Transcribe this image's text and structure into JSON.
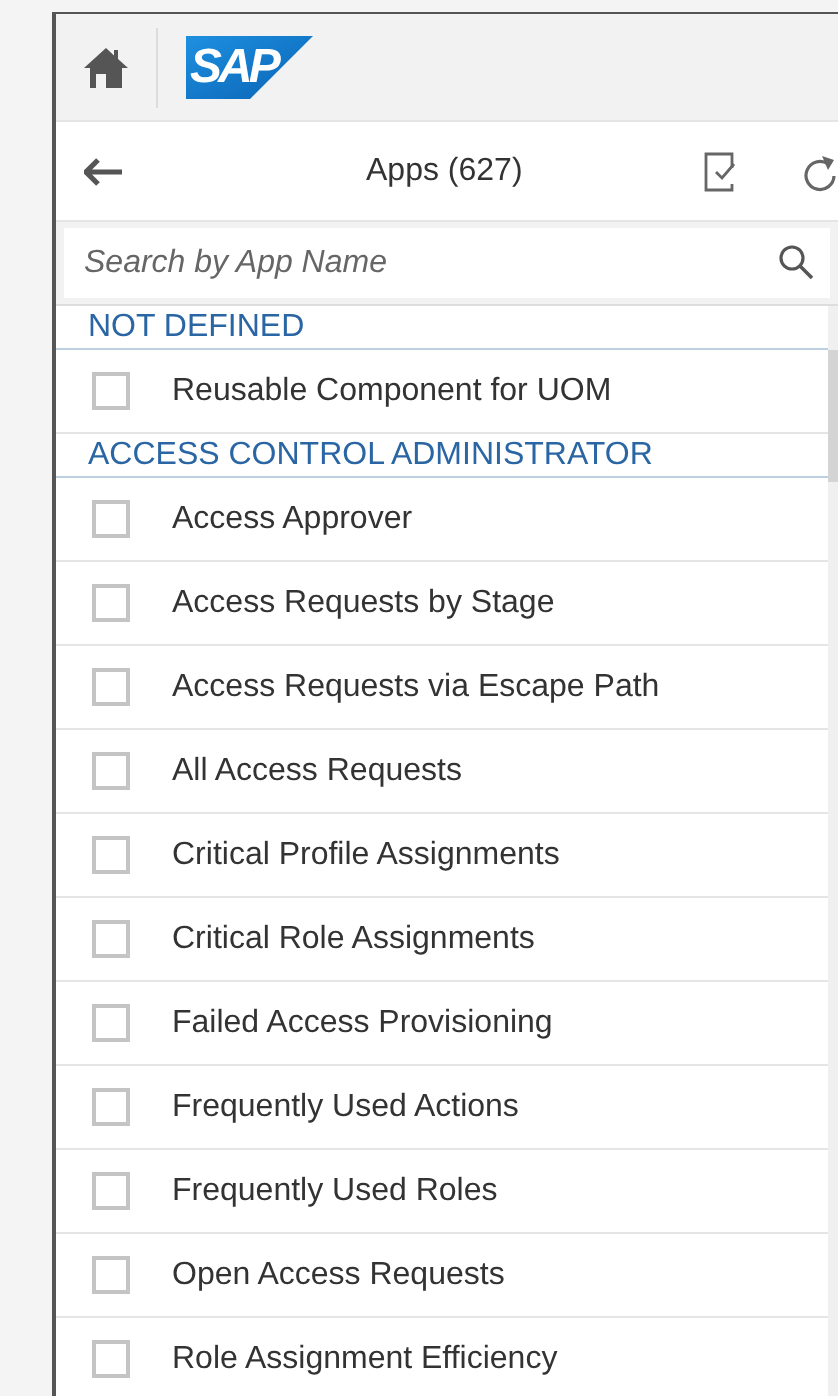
{
  "shell": {
    "logo": "SAP"
  },
  "toolbar": {
    "title": "Apps (627)"
  },
  "search": {
    "placeholder": "Search by App Name"
  },
  "groups": [
    {
      "title": "NOT DEFINED",
      "apps": [
        {
          "label": "Reusable Component for UOM",
          "checked": false
        }
      ]
    },
    {
      "title": "ACCESS CONTROL ADMINISTRATOR",
      "apps": [
        {
          "label": "Access Approver",
          "checked": false
        },
        {
          "label": "Access Requests by Stage",
          "checked": false
        },
        {
          "label": "Access Requests via Escape Path",
          "checked": false
        },
        {
          "label": "All Access Requests",
          "checked": false
        },
        {
          "label": "Critical Profile Assignments",
          "checked": false
        },
        {
          "label": "Critical Role Assignments",
          "checked": false
        },
        {
          "label": "Failed Access Provisioning",
          "checked": false
        },
        {
          "label": "Frequently Used Actions",
          "checked": false
        },
        {
          "label": "Frequently Used Roles",
          "checked": false
        },
        {
          "label": "Open Access Requests",
          "checked": false
        },
        {
          "label": "Role Assignment Efficiency",
          "checked": false
        }
      ]
    }
  ]
}
